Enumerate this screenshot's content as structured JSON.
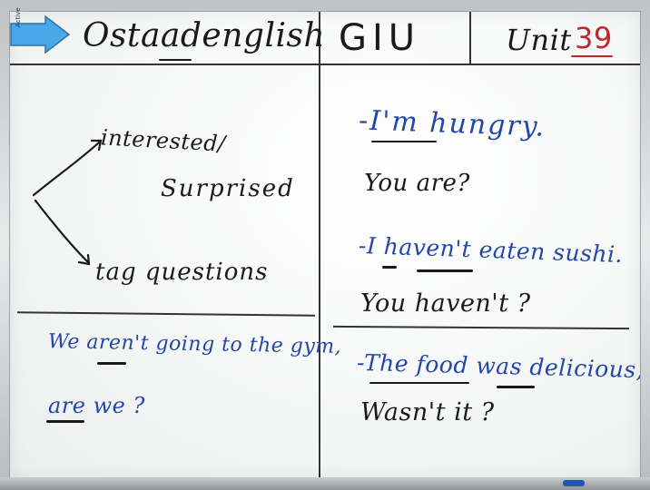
{
  "badge": {
    "label": "Active",
    "color": "#4aa8e8"
  },
  "header": {
    "brand": "Ostaadenglish",
    "course": "GIU",
    "unit_label": "Unit",
    "unit_number": "39"
  },
  "left": {
    "interested": "interested/",
    "surprised": "Surprised",
    "tag_questions": "tag questions",
    "example_sentence": "We aren't going to the gym,",
    "example_tag": "are we ?"
  },
  "right": {
    "ex1_statement": "-I'm hungry.",
    "ex1_response": "You are?",
    "ex2_statement": "-I haven't eaten sushi.",
    "ex2_response": "You haven't ?",
    "ex3_statement": "-The food was delicious,",
    "ex3_tag": "Wasn't it ?"
  },
  "colors": {
    "ink_black": "#1a1a1a",
    "ink_blue": "#2347a8",
    "ink_red": "#c0262a"
  }
}
